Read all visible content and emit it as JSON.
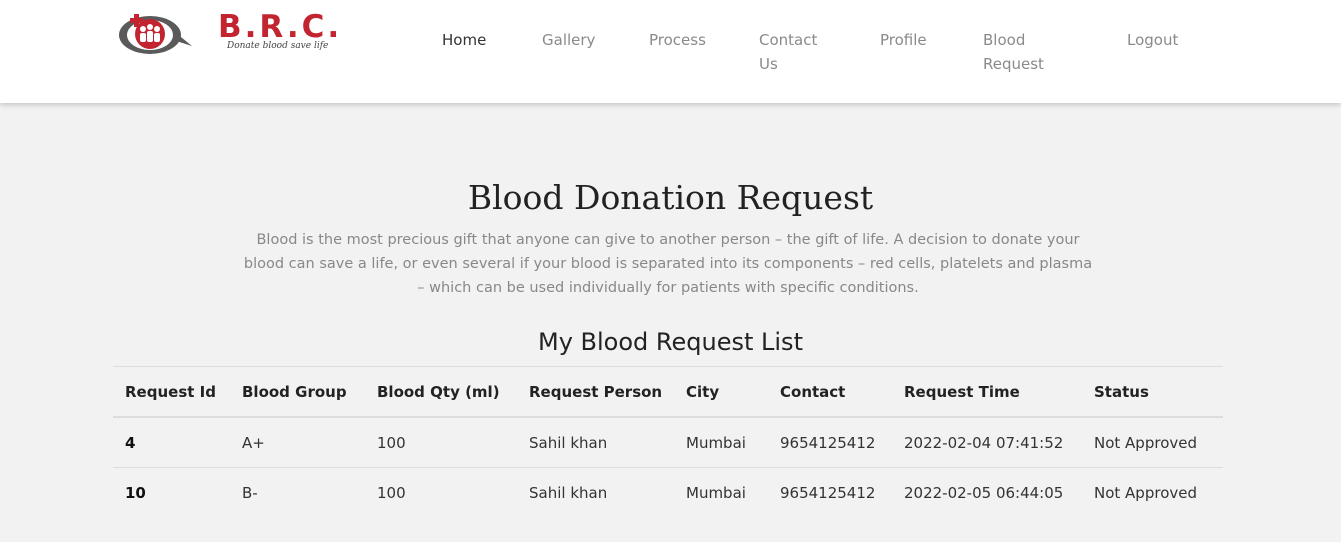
{
  "brand": {
    "name": "B.R.C.",
    "tagline": "Donate blood save life",
    "colors": {
      "primary": "#c22430",
      "secondary": "#5a5a5a"
    }
  },
  "nav": {
    "items": [
      {
        "label": "Home",
        "active": true
      },
      {
        "label": "Gallery"
      },
      {
        "label": "Process"
      },
      {
        "label": "Contact Us"
      },
      {
        "label": "Profile"
      },
      {
        "label": "Blood Request"
      },
      {
        "label": "Logout"
      }
    ]
  },
  "main": {
    "title": "Blood Donation Request",
    "description": "Blood is the most precious gift that anyone can give to another person – the gift of life. A decision to donate your blood can save a life, or even several if your blood is separated into its components – red cells, platelets and plasma – which can be used individually for patients with specific conditions.",
    "list_title": "My Blood Request List"
  },
  "table": {
    "columns": [
      "Request Id",
      "Blood Group",
      "Blood Qty (ml)",
      "Request Person",
      "City",
      "Contact",
      "Request Time",
      "Status"
    ],
    "rows": [
      [
        "4",
        "A+",
        "100",
        "Sahil khan",
        "Mumbai",
        "9654125412",
        "2022-02-04 07:41:52",
        "Not Approved"
      ],
      [
        "10",
        "B-",
        "100",
        "Sahil khan",
        "Mumbai",
        "9654125412",
        "2022-02-05 06:44:05",
        "Not Approved"
      ]
    ]
  }
}
